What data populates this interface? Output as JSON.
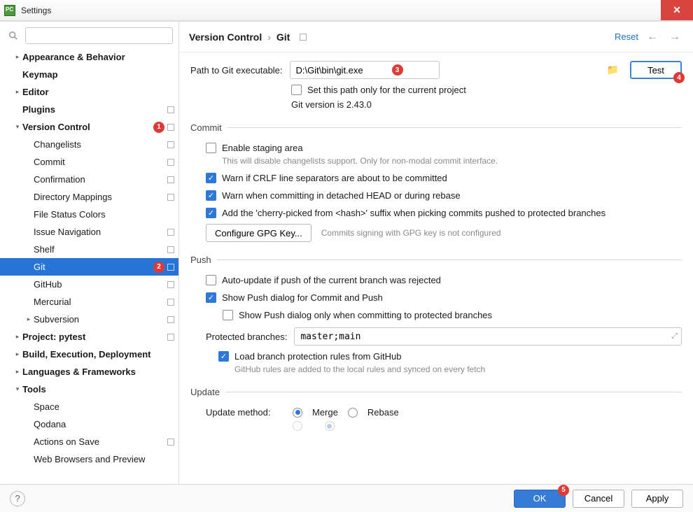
{
  "window": {
    "title": "Settings"
  },
  "sidebar": {
    "search_placeholder": "",
    "items": [
      {
        "label": "Appearance & Behavior",
        "bold": true,
        "indent": 1,
        "arrow": "right"
      },
      {
        "label": "Keymap",
        "bold": true,
        "indent": 1
      },
      {
        "label": "Editor",
        "bold": true,
        "indent": 1,
        "arrow": "right"
      },
      {
        "label": "Plugins",
        "bold": true,
        "indent": 1,
        "square": true
      },
      {
        "label": "Version Control",
        "bold": true,
        "indent": 1,
        "arrow": "down",
        "square": true,
        "callout": "1"
      },
      {
        "label": "Changelists",
        "indent": 2,
        "square": true
      },
      {
        "label": "Commit",
        "indent": 2,
        "square": true
      },
      {
        "label": "Confirmation",
        "indent": 2,
        "square": true
      },
      {
        "label": "Directory Mappings",
        "indent": 2,
        "square": true
      },
      {
        "label": "File Status Colors",
        "indent": 2
      },
      {
        "label": "Issue Navigation",
        "indent": 2,
        "square": true
      },
      {
        "label": "Shelf",
        "indent": 2,
        "square": true
      },
      {
        "label": "Git",
        "indent": 2,
        "square": true,
        "selected": true,
        "callout": "2"
      },
      {
        "label": "GitHub",
        "indent": 2,
        "square": true
      },
      {
        "label": "Mercurial",
        "indent": 2,
        "square": true
      },
      {
        "label": "Subversion",
        "indent": 2,
        "arrow": "right",
        "square": true
      },
      {
        "label": "Project: pytest",
        "bold": true,
        "indent": 1,
        "arrow": "right",
        "square": true
      },
      {
        "label": "Build, Execution, Deployment",
        "bold": true,
        "indent": 1,
        "arrow": "right"
      },
      {
        "label": "Languages & Frameworks",
        "bold": true,
        "indent": 1,
        "arrow": "right"
      },
      {
        "label": "Tools",
        "bold": true,
        "indent": 1,
        "arrow": "down"
      },
      {
        "label": "Space",
        "indent": 2
      },
      {
        "label": "Qodana",
        "indent": 2
      },
      {
        "label": "Actions on Save",
        "indent": 2,
        "square": true
      },
      {
        "label": "Web Browsers and Preview",
        "indent": 2
      }
    ]
  },
  "breadcrumb": {
    "root": "Version Control",
    "leaf": "Git"
  },
  "header": {
    "reset": "Reset"
  },
  "git": {
    "path_label": "Path to Git executable:",
    "path_value": "D:\\Git\\bin\\git.exe",
    "path_callout": "3",
    "test_label": "Test",
    "test_callout": "4",
    "set_only_current": "Set this path only for the current project",
    "version_text": "Git version is 2.43.0"
  },
  "commit": {
    "legend": "Commit",
    "enable_staging": "Enable staging area",
    "enable_staging_hint": "This will disable changelists support. Only for non-modal commit interface.",
    "warn_crlf": "Warn if CRLF line separators are about to be committed",
    "warn_detached": "Warn when committing in detached HEAD or during rebase",
    "cherry_suffix": "Add the 'cherry-picked from <hash>' suffix when picking commits pushed to protected branches",
    "configure_gpg": "Configure GPG Key...",
    "gpg_hint": "Commits signing with GPG key is not configured"
  },
  "push": {
    "legend": "Push",
    "auto_update": "Auto-update if push of the current branch was rejected",
    "show_push_dialog": "Show Push dialog for Commit and Push",
    "show_push_protected": "Show Push dialog only when committing to protected branches",
    "protected_label": "Protected branches:",
    "protected_value": "master;main",
    "load_github": "Load branch protection rules from GitHub",
    "load_github_hint": "GitHub rules are added to the local rules and synced on every fetch"
  },
  "update": {
    "legend": "Update",
    "method_label": "Update method:",
    "merge": "Merge",
    "rebase": "Rebase"
  },
  "footer": {
    "ok": "OK",
    "ok_callout": "5",
    "cancel": "Cancel",
    "apply": "Apply"
  }
}
